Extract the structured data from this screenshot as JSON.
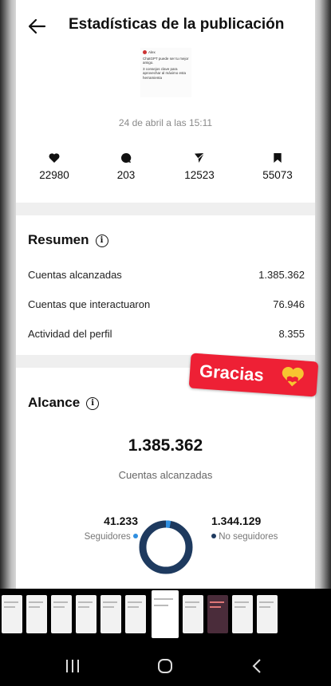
{
  "header": {
    "title": "Estadísticas de la publicación"
  },
  "post": {
    "thumb_user": "Alex",
    "thumb_lines": [
      "ChatGPT puede ser tu mejor amigo.",
      "3 consejos clave para aprovechar al máximo esta herramienta"
    ],
    "date": "24 de abril a las 15:11"
  },
  "stats": {
    "likes": "22980",
    "comments": "203",
    "shares": "12523",
    "saves": "55073"
  },
  "summary": {
    "title": "Resumen",
    "rows": [
      {
        "label": "Cuentas alcanzadas",
        "value": "1.385.362"
      },
      {
        "label": "Cuentas que interactuaron",
        "value": "76.946"
      },
      {
        "label": "Actividad del perfil",
        "value": "8.355"
      }
    ]
  },
  "sticker": {
    "text": "Gracias"
  },
  "reach": {
    "title": "Alcance",
    "total": "1.385.362",
    "total_label": "Cuentas alcanzadas",
    "followers": "41.233",
    "followers_label": "Seguidores",
    "non_followers": "1.344.129",
    "non_followers_label": "No seguidores",
    "followers_share": 0.03
  },
  "colors": {
    "followers": "#2f8fe0",
    "non_followers": "#1e3a5f",
    "sticker": "#ee2035"
  },
  "icons": {
    "back": "arrow-left-icon",
    "likes": "heart-icon",
    "comments": "comment-icon",
    "shares": "send-icon",
    "saves": "bookmark-icon",
    "info": "info-icon"
  }
}
